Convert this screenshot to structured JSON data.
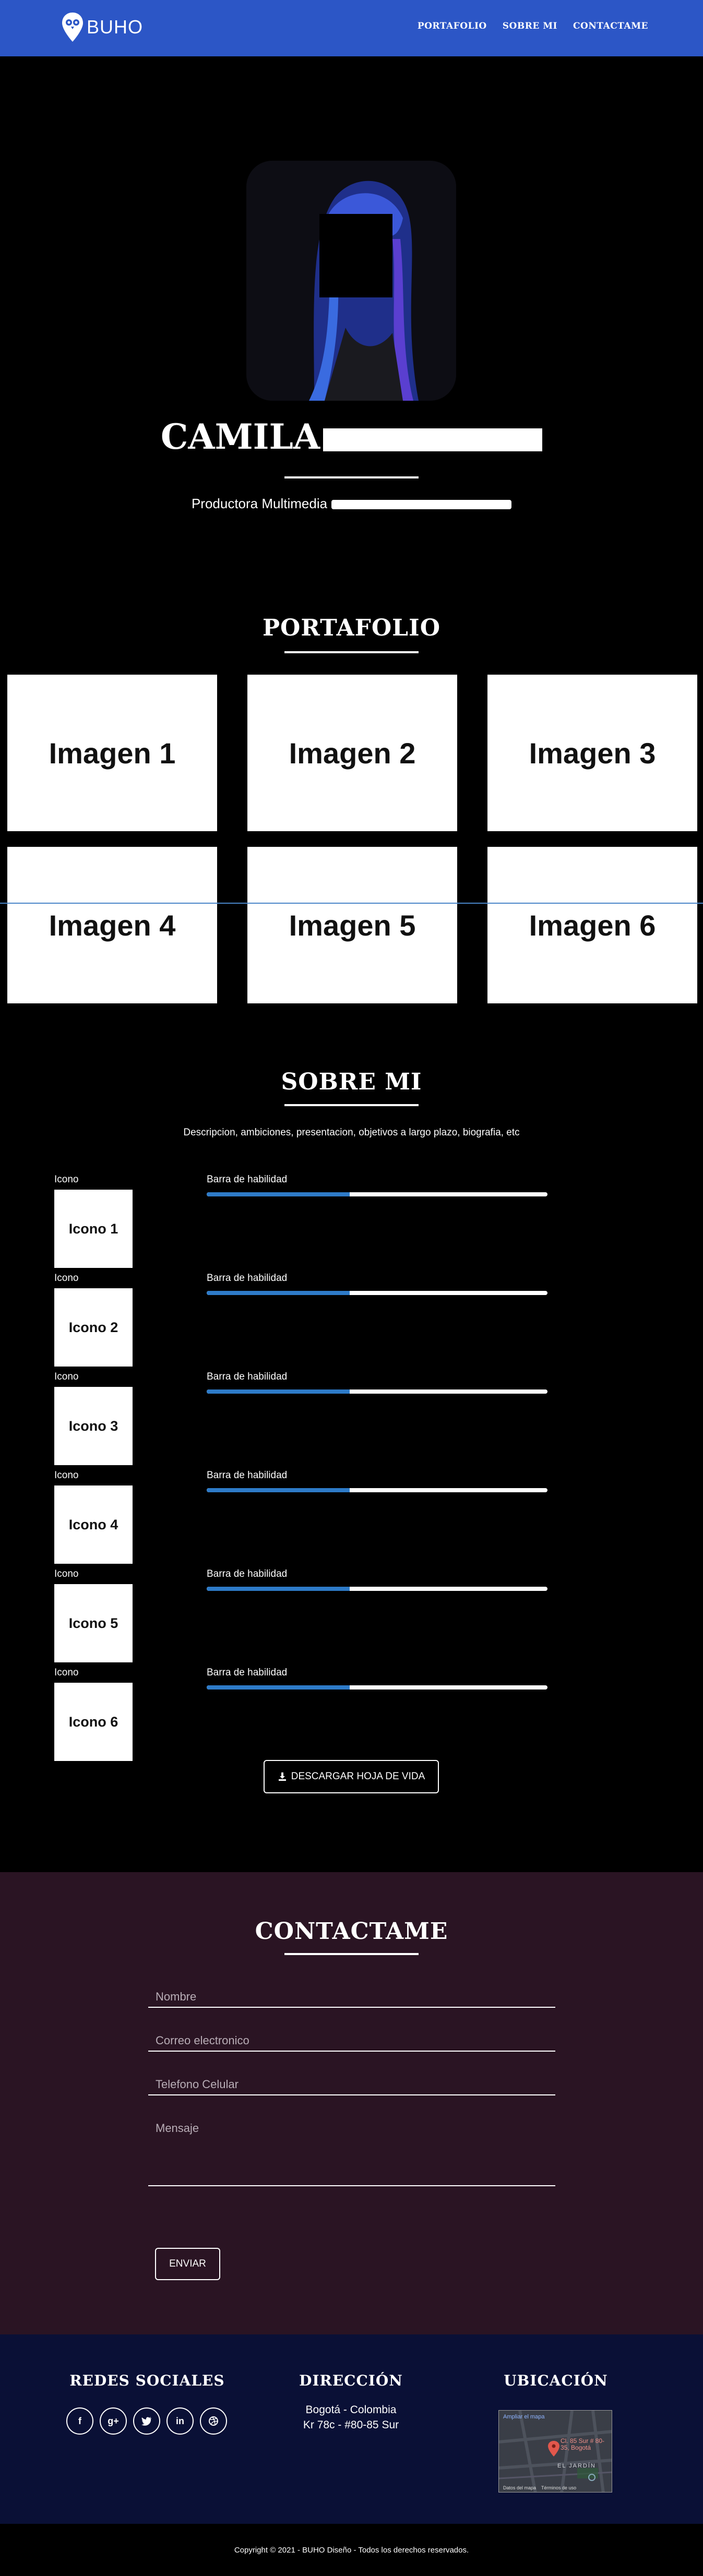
{
  "nav": {
    "brand": "BUHO",
    "links": [
      "PORTAFOLIO",
      "SOBRE MI",
      "CONTACTAME"
    ]
  },
  "hero": {
    "name": "CAMILA",
    "title": "Productora Multimedia"
  },
  "portfolio": {
    "title": "PORTAFOLIO",
    "images": [
      "Imagen 1",
      "Imagen 2",
      "Imagen 3",
      "Imagen 4",
      "Imagen 5",
      "Imagen 6"
    ]
  },
  "about": {
    "title": "SOBRE MI",
    "description": "Descripcion, ambiciones, presentacion, objetivos a largo plazo, biografia, etc",
    "skills": [
      {
        "icon_label": "Icono",
        "icon_text": "Icono 1",
        "bar_label": "Barra de habilidad",
        "level": 0.42
      },
      {
        "icon_label": "Icono",
        "icon_text": "Icono 2",
        "bar_label": "Barra de habilidad",
        "level": 0.42
      },
      {
        "icon_label": "Icono",
        "icon_text": "Icono 3",
        "bar_label": "Barra de habilidad",
        "level": 0.42
      },
      {
        "icon_label": "Icono",
        "icon_text": "Icono 4",
        "bar_label": "Barra de habilidad",
        "level": 0.42
      },
      {
        "icon_label": "Icono",
        "icon_text": "Icono 5",
        "bar_label": "Barra de habilidad",
        "level": 0.42
      },
      {
        "icon_label": "Icono",
        "icon_text": "Icono 6",
        "bar_label": "Barra de habilidad",
        "level": 0.42
      }
    ],
    "cv_button": "DESCARGAR HOJA DE VIDA"
  },
  "contact": {
    "title": "CONTACTAME",
    "fields": [
      "Nombre",
      "Correo electronico",
      "Telefono Celular",
      "Mensaje"
    ],
    "send_button": "ENVIAR"
  },
  "footer": {
    "social_title": "REDES SOCIALES",
    "address_title": "DIRECCIÓN",
    "address_lines": [
      "Bogotá - Colombia",
      "Kr 78c - #80-85 Sur"
    ],
    "location_title": "UBICACIÓN",
    "social_icons": [
      "facebook-icon",
      "google-plus-icon",
      "twitter-icon",
      "linkedin-icon",
      "dribbble-icon"
    ],
    "map": {
      "link": "Ampliar el mapa",
      "pin_label": "Cl. 85 Sur # 80-35, Bogotá",
      "district": "EL JARDÍN",
      "footer_links": [
        "Datos del mapa",
        "Términos de uso"
      ]
    }
  },
  "copyright": "Copyright © 2021 - BUHO Diseño - Todos los derechos reservados.",
  "colors": {
    "nav": "#2c56c6",
    "contact_bg": "#2a1423",
    "footer_bg": "#0a1036",
    "skill_fill": "#2e7bc8"
  }
}
